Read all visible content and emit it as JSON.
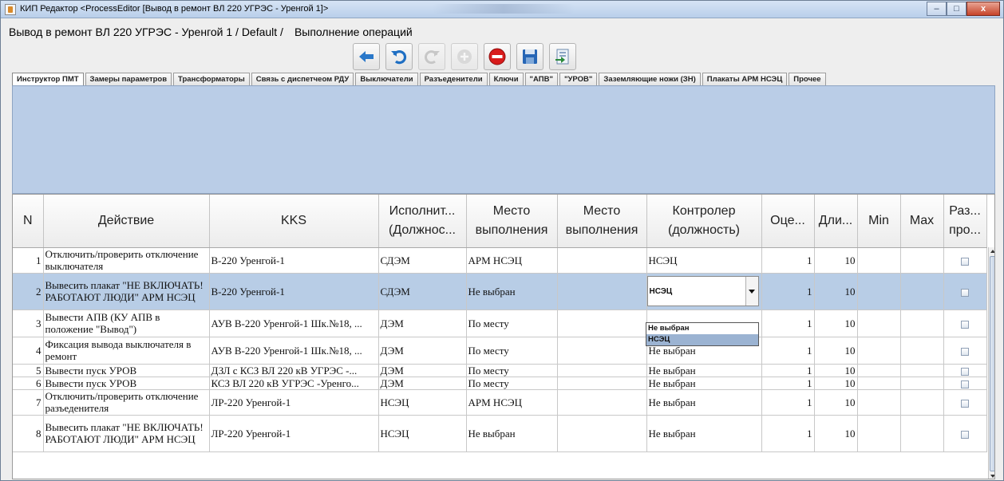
{
  "window": {
    "title": "КИП Редактор <ProcessEditor [Вывод в ремонт ВЛ 220 УГРЭС - Уренгой 1]>",
    "minimize_glyph": "–",
    "maximize_glyph": "□",
    "close_glyph": "x"
  },
  "header": {
    "path": "Вывод в ремонт ВЛ 220 УГРЭС - Уренгой 1 / Default /",
    "section": "Выполнение операций"
  },
  "toolbar": {
    "buttons": [
      {
        "icon": "arrow-left-icon",
        "enabled": true
      },
      {
        "icon": "undo-icon",
        "enabled": true
      },
      {
        "icon": "redo-icon",
        "enabled": false
      },
      {
        "icon": "add-circle-icon",
        "enabled": false
      },
      {
        "icon": "stop-minus-icon",
        "enabled": true
      },
      {
        "icon": "save-floppy-icon",
        "enabled": true
      },
      {
        "icon": "export-icon",
        "enabled": true
      }
    ]
  },
  "tabs": [
    "Инструктор ПМТ",
    "Замеры параметров",
    "Трансформаторы",
    "Связь с диспетчеом РДУ",
    "Выключатели",
    "Разъеденители",
    "Ключи",
    "\"АПВ\"",
    "\"УРОВ\"",
    "Заземляющие ножи (ЗН)",
    "Плакаты АРМ НСЭЦ",
    "Прочее"
  ],
  "active_tab": 0,
  "table": {
    "columns": [
      {
        "l1": "N",
        "l2": ""
      },
      {
        "l1": "Действие",
        "l2": ""
      },
      {
        "l1": "KKS",
        "l2": ""
      },
      {
        "l1": "Исполнит...",
        "l2": "(Должнос..."
      },
      {
        "l1": "Место",
        "l2": "выполнения"
      },
      {
        "l1": "Место",
        "l2": "выполнения"
      },
      {
        "l1": "Контролер",
        "l2": "(должность)"
      },
      {
        "l1": "Оце...",
        "l2": ""
      },
      {
        "l1": "Дли...",
        "l2": ""
      },
      {
        "l1": "Min",
        "l2": ""
      },
      {
        "l1": "Max",
        "l2": ""
      },
      {
        "l1": "Раз...",
        "l2": "про..."
      }
    ],
    "rows": [
      {
        "n": "1",
        "action": "Отключить/проверить отключение выключателя",
        "kks": "В-220 Уренгой-1",
        "executor": "СДЭМ",
        "place": "АРМ НСЭЦ",
        "place2": "",
        "controller": "НСЭЦ",
        "score": "1",
        "duration": "10",
        "min": "",
        "max": "",
        "checked": false
      },
      {
        "n": "2",
        "action": "Вывесить плакат \"НЕ ВКЛЮЧАТЬ! РАБОТАЮТ ЛЮДИ\" АРМ НСЭЦ",
        "kks": "В-220 Уренгой-1",
        "executor": "СДЭМ",
        "place": "Не выбран",
        "place2": "",
        "controller": "НСЭЦ",
        "score": "1",
        "duration": "10",
        "min": "",
        "max": "",
        "checked": false
      },
      {
        "n": "3",
        "action": "Вывести АПВ  (КУ АПВ в положение \"Вывод\")",
        "kks": "АУВ В-220 Уренгой-1 Шк.№18, ...",
        "executor": "ДЭМ",
        "place": "По месту",
        "place2": "",
        "controller": "",
        "score": "1",
        "duration": "10",
        "min": "",
        "max": "",
        "checked": false
      },
      {
        "n": "4",
        "action": "Фиксация вывода выключателя в ремонт",
        "kks": "АУВ В-220 Уренгой-1 Шк.№18, ...",
        "executor": "ДЭМ",
        "place": "По месту",
        "place2": "",
        "controller": "Не выбран",
        "score": "1",
        "duration": "10",
        "min": "",
        "max": "",
        "checked": false
      },
      {
        "n": "5",
        "action": "Вывести пуск УРОВ",
        "kks": "ДЗЛ с КСЗ ВЛ 220 кВ УГРЭС -...",
        "executor": "ДЭМ",
        "place": "По месту",
        "place2": "",
        "controller": "Не выбран",
        "score": "1",
        "duration": "10",
        "min": "",
        "max": "",
        "checked": false
      },
      {
        "n": "6",
        "action": "Вывести пуск УРОВ",
        "kks": "КСЗ ВЛ 220 кВ УГРЭС -Уренго...",
        "executor": "ДЭМ",
        "place": "По месту",
        "place2": "",
        "controller": "Не выбран",
        "score": "1",
        "duration": "10",
        "min": "",
        "max": "",
        "checked": false
      },
      {
        "n": "7",
        "action": "Отключить/проверить отключение разъеденителя",
        "kks": "ЛР-220 Уренгой-1",
        "executor": "НСЭЦ",
        "place": "АРМ НСЭЦ",
        "place2": "",
        "controller": "Не выбран",
        "score": "1",
        "duration": "10",
        "min": "",
        "max": "",
        "checked": false
      },
      {
        "n": "8",
        "action": "Вывесить плакат \"НЕ ВКЛЮЧАТЬ! РАБОТАЮТ ЛЮДИ\" АРМ НСЭЦ",
        "kks": "ЛР-220 Уренгой-1",
        "executor": "НСЭЦ",
        "place": "Не выбран",
        "place2": "",
        "controller": "Не выбран",
        "score": "1",
        "duration": "10",
        "min": "",
        "max": "",
        "checked": false
      }
    ],
    "selected_row": 1,
    "editor": {
      "value": "НСЭЦ"
    },
    "dropdown_options": [
      "Не выбран",
      "НСЭЦ"
    ],
    "dropdown_selected": 1
  }
}
